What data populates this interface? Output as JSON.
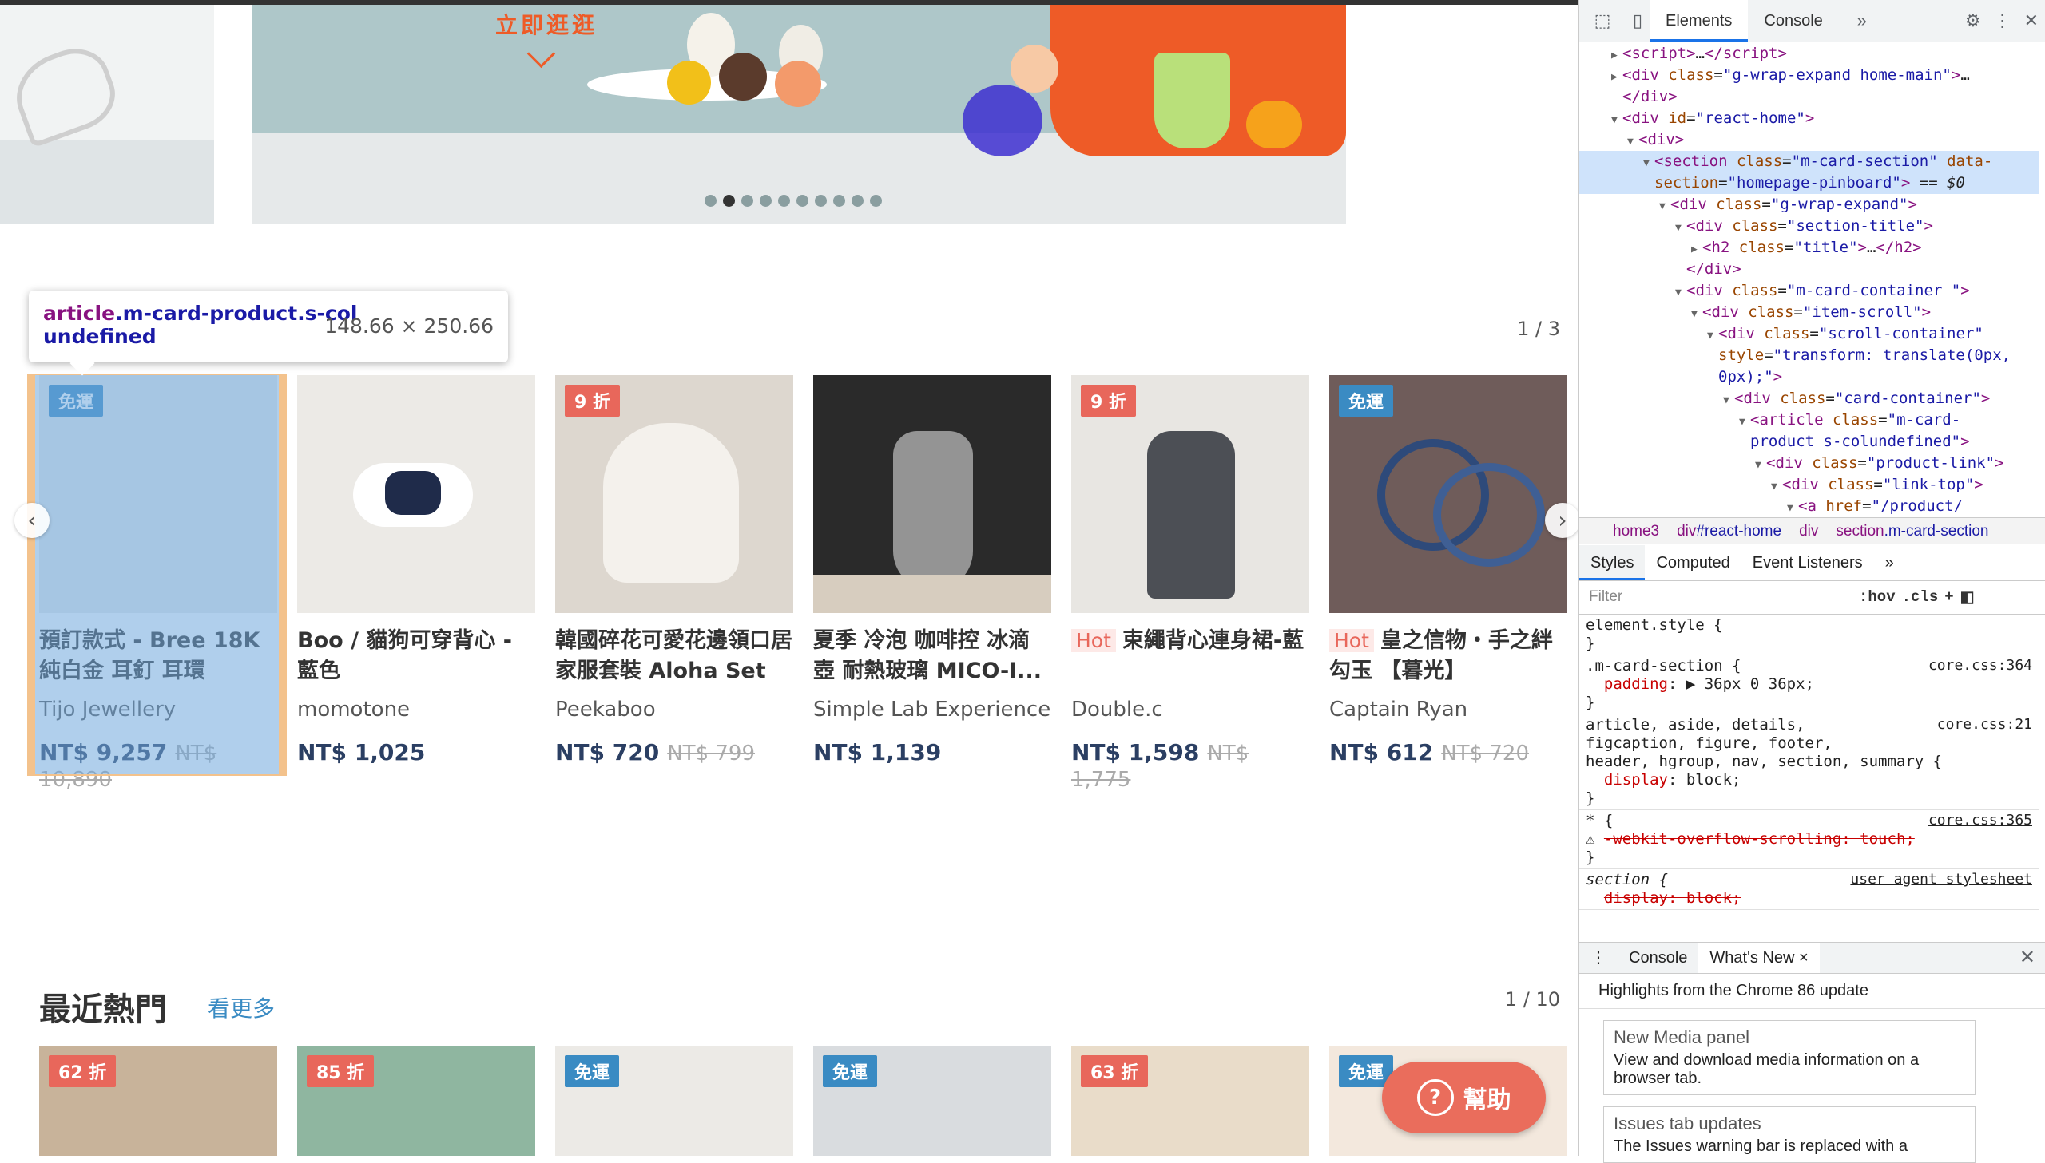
{
  "banner": {
    "cta": "立即逛逛",
    "dots_count": 10,
    "active_dot": 2
  },
  "section1": {
    "pager": "1 / 3",
    "products": [
      {
        "badge": "免運",
        "badge_type": "free",
        "hot": "",
        "title": "預訂款式 - Bree 18K純白金 耳釘 耳環",
        "brand": "Tijo Jewellery",
        "price": "NT$ 9,257",
        "orig": "NT$ 10,890"
      },
      {
        "badge": "",
        "badge_type": "",
        "hot": "",
        "title": "Boo / 貓狗可穿背心 - 藍色",
        "brand": "momotone",
        "price": "NT$ 1,025",
        "orig": ""
      },
      {
        "badge": "9 折",
        "badge_type": "disc",
        "hot": "",
        "title": "韓國碎花可愛花邊領口居家服套裝 Aloha Set",
        "brand": "Peekaboo",
        "price": "NT$ 720",
        "orig": "NT$ 799"
      },
      {
        "badge": "",
        "badge_type": "",
        "hot": "",
        "title": "夏季 冷泡 咖啡控 冰滴壺 耐熱玻璃 MICO-I...",
        "brand": "Simple Lab Experience",
        "price": "NT$ 1,139",
        "orig": ""
      },
      {
        "badge": "9 折",
        "badge_type": "disc",
        "hot": "Hot",
        "title": "束繩背心連身裙-藍",
        "brand": "Double.c",
        "price": "NT$ 1,598",
        "orig": "NT$ 1,775"
      },
      {
        "badge": "免運",
        "badge_type": "free",
        "hot": "Hot",
        "title": "皇之信物・手之絆勾玉 【暮光】",
        "brand": "Captain Ryan",
        "price": "NT$ 612",
        "orig": "NT$ 720"
      }
    ]
  },
  "tooltip": {
    "selector_tag": "article",
    "selector_class": ".m-card-product.s-col",
    "selector_class2": "undefined",
    "dimensions": "148.66 × 250.66"
  },
  "section2": {
    "title": "最近熱門",
    "more": "看更多",
    "pager": "1 / 10",
    "badges": [
      "62 折",
      "85 折",
      "免運",
      "免運",
      "63 折",
      "免運"
    ]
  },
  "help": {
    "label": "幫助"
  },
  "devtools": {
    "tabs": [
      "Elements",
      "Console"
    ],
    "dom": [
      {
        "indent": 3,
        "arrow": "▶",
        "html": "<span class='tag'>&lt;script&gt;</span>…<span class='tag'>&lt;/script&gt;</span>"
      },
      {
        "indent": 3,
        "arrow": "▶",
        "html": "<span class='tag'>&lt;div</span> <span class='attr'>class</span>=<span class='val'>\"g-wrap-expand home-main\"</span><span class='tag'>&gt;</span>…"
      },
      {
        "indent": 3,
        "arrow": "",
        "html": "<span class='tag'>&lt;/div&gt;</span>"
      },
      {
        "indent": 3,
        "arrow": "▼",
        "html": "<span class='tag'>&lt;div</span> <span class='attr'>id</span>=<span class='val'>\"react-home\"</span><span class='tag'>&gt;</span>"
      },
      {
        "indent": 4,
        "arrow": "▼",
        "html": "<span class='tag'>&lt;div&gt;</span>"
      },
      {
        "indent": 5,
        "arrow": "▼",
        "html": "<span class='tag'>&lt;section</span> <span class='attr'>class</span>=<span class='val'>\"m-card-section\"</span> <span class='attr'>data-</span>",
        "sel": true
      },
      {
        "indent": 5,
        "arrow": "",
        "html": "<span class='attr'>section</span>=<span class='val'>\"homepage-pinboard\"</span><span class='tag'>&gt;</span> == <i>$0</i>",
        "sel": true
      },
      {
        "indent": 6,
        "arrow": "▼",
        "html": "<span class='tag'>&lt;div</span> <span class='attr'>class</span>=<span class='val'>\"g-wrap-expand\"</span><span class='tag'>&gt;</span>"
      },
      {
        "indent": 7,
        "arrow": "▼",
        "html": "<span class='tag'>&lt;div</span> <span class='attr'>class</span>=<span class='val'>\"section-title\"</span><span class='tag'>&gt;</span>"
      },
      {
        "indent": 8,
        "arrow": "▶",
        "html": "<span class='tag'>&lt;h2</span> <span class='attr'>class</span>=<span class='val'>\"title\"</span><span class='tag'>&gt;</span>…<span class='tag'>&lt;/h2&gt;</span>"
      },
      {
        "indent": 7,
        "arrow": "",
        "html": "<span class='tag'>&lt;/div&gt;</span>"
      },
      {
        "indent": 7,
        "arrow": "▼",
        "html": "<span class='tag'>&lt;div</span> <span class='attr'>class</span>=<span class='val'>\"m-card-container \"</span><span class='tag'>&gt;</span>"
      },
      {
        "indent": 8,
        "arrow": "▼",
        "html": "<span class='tag'>&lt;div</span> <span class='attr'>class</span>=<span class='val'>\"item-scroll\"</span><span class='tag'>&gt;</span>"
      },
      {
        "indent": 9,
        "arrow": "▼",
        "html": "<span class='tag'>&lt;div</span> <span class='attr'>class</span>=<span class='val'>\"scroll-container\"</span>"
      },
      {
        "indent": 9,
        "arrow": "",
        "html": "<span class='attr'>style</span>=<span class='val'>\"transform: translate(0px,</span>"
      },
      {
        "indent": 9,
        "arrow": "",
        "html": "<span class='val'>0px);\"</span><span class='tag'>&gt;</span>"
      },
      {
        "indent": 10,
        "arrow": "▼",
        "html": "<span class='tag'>&lt;div</span> <span class='attr'>class</span>=<span class='val'>\"card-container\"</span><span class='tag'>&gt;</span>"
      },
      {
        "indent": 11,
        "arrow": "▼",
        "html": "<span class='tag'>&lt;article</span> <span class='attr'>class</span>=<span class='val'>\"m-card-</span>"
      },
      {
        "indent": 11,
        "arrow": "",
        "html": "<span class='val'>product s-colundefined\"</span><span class='tag'>&gt;</span>"
      },
      {
        "indent": 12,
        "arrow": "▼",
        "html": "<span class='tag'>&lt;div</span> <span class='attr'>class</span>=<span class='val'>\"product-link\"</span><span class='tag'>&gt;</span>"
      },
      {
        "indent": 13,
        "arrow": "▼",
        "html": "<span class='tag'>&lt;div</span> <span class='attr'>class</span>=<span class='val'>\"link-top\"</span><span class='tag'>&gt;</span>"
      },
      {
        "indent": 14,
        "arrow": "▼",
        "html": "<span class='tag'>&lt;a</span> <span class='attr'>href</span>=<span class='val'>\"/product/</span>"
      }
    ],
    "crumbs": [
      {
        "t": "home3",
        "v": ""
      },
      {
        "t": "div",
        "v": "#react-home"
      },
      {
        "t": "div",
        "v": ""
      },
      {
        "t": "section",
        "v": ".m-card-section"
      }
    ],
    "style_tabs": [
      "Styles",
      "Computed",
      "Event Listeners"
    ],
    "filter": "Filter",
    "hov": ":hov",
    "cls": ".cls",
    "rules": [
      {
        "lines": [
          "element.style {",
          "}"
        ],
        "src": ""
      },
      {
        "lines": [
          ".m-card-section {",
          "  <span class='prop'>padding</span>: ▶ 36px 0 36px;",
          "}"
        ],
        "src": "core.css:364"
      },
      {
        "lines": [
          "article, aside, details,",
          "figcaption, figure, footer,",
          "header, hgroup, nav, section, summary {",
          "  <span class='prop'>display</span>: block;",
          "}"
        ],
        "src": "core.css:21"
      },
      {
        "lines": [
          "* {",
          "⚠ <span class='strike'>-webkit-overflow-scrolling: touch;</span>",
          "}"
        ],
        "src": "core.css:365"
      },
      {
        "lines": [
          "<i>section {</i>",
          "  <span class='strike'>display: block;</span>"
        ],
        "src": "user agent stylesheet"
      }
    ],
    "drawer_tabs": [
      "Console",
      "What's New"
    ],
    "whatsnew_head": "Highlights from the Chrome 86 update",
    "cards": [
      {
        "h": "New Media panel",
        "d": "View and download media information on a browser tab."
      },
      {
        "h": "Issues tab updates",
        "d": "The Issues warning bar is replaced with a"
      }
    ]
  }
}
